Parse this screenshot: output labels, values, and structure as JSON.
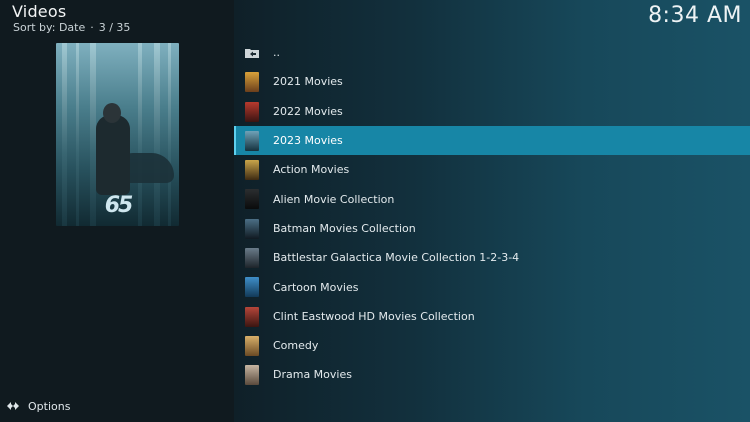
{
  "header": {
    "title": "Videos",
    "sort_label": "Sort by: Date",
    "position": "3 / 35"
  },
  "clock": "8:34 AM",
  "poster": {
    "caption": "65"
  },
  "footer": {
    "options_label": "Options",
    "options_icon": "options-icon"
  },
  "list": {
    "items": [
      {
        "label": "..",
        "icon": "parent-folder-icon",
        "thumb_colors": [
          "#cfd6d9",
          "#cfd6d9"
        ]
      },
      {
        "label": "2021 Movies",
        "thumb_colors": [
          "#d9a23a",
          "#6b3f1c"
        ]
      },
      {
        "label": "2022 Movies",
        "thumb_colors": [
          "#b83a2e",
          "#3a1412"
        ]
      },
      {
        "label": "2023 Movies",
        "thumb_colors": [
          "#6fa2b8",
          "#15323e"
        ],
        "selected": true
      },
      {
        "label": "Action Movies",
        "thumb_colors": [
          "#c9a54a",
          "#3d2a12"
        ]
      },
      {
        "label": "Alien Movie Collection",
        "thumb_colors": [
          "#2b2e30",
          "#0a0b0c"
        ]
      },
      {
        "label": "Batman Movies Collection",
        "thumb_colors": [
          "#4b6f86",
          "#101a22"
        ]
      },
      {
        "label": "Battlestar Galactica Movie Collection 1-2-3-4",
        "thumb_colors": [
          "#6a7c8a",
          "#1d242a"
        ]
      },
      {
        "label": "Cartoon Movies",
        "thumb_colors": [
          "#3f8fc9",
          "#123a58"
        ]
      },
      {
        "label": "Clint Eastwood HD Movies Collection",
        "thumb_colors": [
          "#b5463a",
          "#3b1511"
        ]
      },
      {
        "label": "Comedy",
        "thumb_colors": [
          "#d8b06a",
          "#6b4a24"
        ]
      },
      {
        "label": "Drama Movies",
        "thumb_colors": [
          "#c7b6a3",
          "#5a4a3c"
        ]
      }
    ]
  },
  "colors": {
    "selection": "#1786a6",
    "background": "#0e1b22",
    "panel": "#101a1f"
  }
}
